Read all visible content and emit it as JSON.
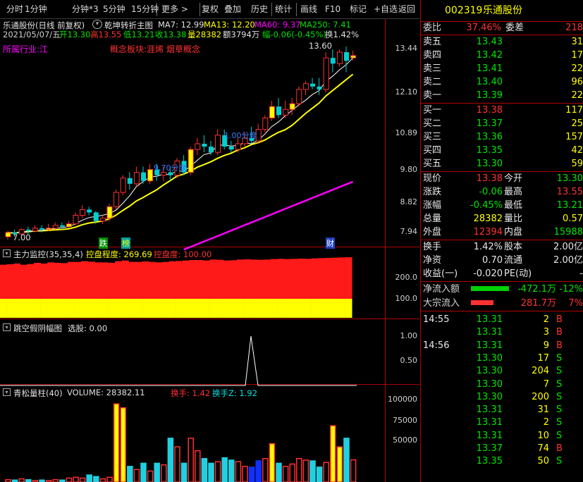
{
  "toolbar": {
    "items": [
      "分时",
      "1分钟",
      "分钟*3",
      "5分钟",
      "15分钟",
      "更多 >",
      "复权",
      "叠加",
      "历史",
      "统计",
      "画线",
      "F10",
      "标记",
      "+自选",
      "返回"
    ]
  },
  "chart_header": {
    "stock_period": "乐通股份(日线 前复权)",
    "indicator_name": "乾坤转折主图",
    "ma7": "MA7: 12.99",
    "ma13": "MA13: 12.20",
    "ma60": "MA60: 9.37",
    "ma250": "MA250: 7.41",
    "date": "2021/05/07/五",
    "open": "开13.30",
    "high": "高13.55",
    "low": "低13.21",
    "close": "收13.38",
    "volume": "量28382",
    "amount": "额3794万",
    "change": "幅-0.06(-0.45%)",
    "turnover": "换1.42%",
    "industry": "所属行业:江",
    "concepts": "概念板块:涯烯 烟草概念",
    "price_max_label": "13.60",
    "price_min_label": "7.00",
    "marker_die": "跌",
    "marker_bang": "榜",
    "marker_cai": "财",
    "band_label_1": "1.00分度",
    "band_label_2": "9.70分度"
  },
  "price_axis": [
    "13.44",
    "12.10",
    "10.89",
    "9.80",
    "8.82",
    "7.94"
  ],
  "panel2": {
    "title": "主力监控(35,35,4)",
    "ctrl_degree": "控盘程度: 269.69",
    "ctrl": "控盘度: 100.00",
    "axis": [
      "200.0",
      "100.0"
    ]
  },
  "panel3": {
    "title": "跳空假阴幅图",
    "select": "选股: 0.00",
    "axis": [
      "1.00",
      "0.50"
    ]
  },
  "panel4": {
    "title": "青松量柱(40)",
    "volume": "VOLUME: 28382.11",
    "turnover": "换手: 1.42",
    "turnover_z": "换手Z: 1.92",
    "axis": [
      "100000",
      "75000",
      "50000"
    ]
  },
  "quote": {
    "code": "002319",
    "name": "乐通股份",
    "weibi_label": "委比",
    "weibi_value": "37.46%",
    "weicha_label": "委差",
    "weicha_value": "218",
    "asks": [
      {
        "label": "卖五",
        "price": "13.43",
        "vol": "31"
      },
      {
        "label": "卖四",
        "price": "13.42",
        "vol": "17"
      },
      {
        "label": "卖三",
        "price": "13.41",
        "vol": "22"
      },
      {
        "label": "卖二",
        "price": "13.40",
        "vol": "96"
      },
      {
        "label": "卖一",
        "price": "13.39",
        "vol": "22"
      }
    ],
    "bids": [
      {
        "label": "买一",
        "price": "13.38",
        "vol": "117"
      },
      {
        "label": "买二",
        "price": "13.37",
        "vol": "25"
      },
      {
        "label": "买三",
        "price": "13.36",
        "vol": "157"
      },
      {
        "label": "买四",
        "price": "13.35",
        "vol": "42"
      },
      {
        "label": "买五",
        "price": "13.30",
        "vol": "59"
      }
    ],
    "stats": [
      {
        "l1": "现价",
        "v1": "13.38",
        "c1": "red",
        "l2": "今开",
        "v2": "13.30",
        "c2": "green"
      },
      {
        "l1": "涨跌",
        "v1": "-0.06",
        "c1": "green",
        "l2": "最高",
        "v2": "13.55",
        "c2": "red"
      },
      {
        "l1": "涨幅",
        "v1": "-0.45%",
        "c1": "green",
        "l2": "最低",
        "v2": "13.21",
        "c2": "green"
      },
      {
        "l1": "总量",
        "v1": "28382",
        "c1": "yellow",
        "l2": "量比",
        "v2": "0.57",
        "c2": "yellow"
      },
      {
        "l1": "外盘",
        "v1": "12394",
        "c1": "red",
        "l2": "内盘",
        "v2": "15988",
        "c2": "green"
      }
    ],
    "stats2": [
      {
        "l1": "换手",
        "v1": "1.42%",
        "l2": "股本",
        "v2": "2.00亿"
      },
      {
        "l1": "净资",
        "v1": "0.70",
        "l2": "流通",
        "v2": "2.00亿"
      },
      {
        "l1": "收益(一)",
        "v1": "-0.020",
        "l2": "PE(动)",
        "v2": "-"
      }
    ],
    "net_inflow_label": "净流入额",
    "net_inflow_value": "-472.1万",
    "net_inflow_pct": "-12%",
    "block_inflow_label": "大宗流入",
    "block_inflow_value": "281.7万",
    "block_inflow_pct": "7%",
    "ticks": [
      {
        "time": "14:55",
        "price": "13.31",
        "vol": "2",
        "dir": "B",
        "c": "red"
      },
      {
        "time": "",
        "price": "13.31",
        "vol": "3",
        "dir": "B",
        "c": "red"
      },
      {
        "time": "14:56",
        "price": "13.31",
        "vol": "9",
        "dir": "B",
        "c": "red"
      },
      {
        "time": "",
        "price": "13.30",
        "vol": "17",
        "dir": "S",
        "c": "green"
      },
      {
        "time": "",
        "price": "13.30",
        "vol": "204",
        "dir": "S",
        "c": "green"
      },
      {
        "time": "",
        "price": "13.30",
        "vol": "7",
        "dir": "S",
        "c": "green"
      },
      {
        "time": "",
        "price": "13.30",
        "vol": "200",
        "dir": "S",
        "c": "green"
      },
      {
        "time": "",
        "price": "13.31",
        "vol": "31",
        "dir": "S",
        "c": "green"
      },
      {
        "time": "",
        "price": "13.31",
        "vol": "2",
        "dir": "S",
        "c": "green"
      },
      {
        "time": "",
        "price": "13.31",
        "vol": "10",
        "dir": "S",
        "c": "green"
      },
      {
        "time": "",
        "price": "13.37",
        "vol": "74",
        "dir": "B",
        "c": "red"
      },
      {
        "time": "",
        "price": "13.35",
        "vol": "50",
        "dir": "S",
        "c": "green"
      }
    ]
  },
  "chart_data": {
    "type": "candlestick",
    "y_range": [
      7.0,
      13.9
    ],
    "candles": [
      [
        7.05,
        7.2,
        6.95,
        7.25
      ],
      [
        7.2,
        7.15,
        7.05,
        7.3
      ],
      [
        7.15,
        7.3,
        7.1,
        7.35
      ],
      [
        7.3,
        7.25,
        7.15,
        7.4
      ],
      [
        7.25,
        7.35,
        7.2,
        7.45
      ],
      [
        7.35,
        7.3,
        7.2,
        7.45
      ],
      [
        7.3,
        7.35,
        7.25,
        7.5
      ],
      [
        7.35,
        7.45,
        7.3,
        7.55
      ],
      [
        7.45,
        7.4,
        7.3,
        7.55
      ],
      [
        7.4,
        7.5,
        7.35,
        7.6
      ],
      [
        7.5,
        7.8,
        7.45,
        7.9
      ],
      [
        7.8,
        8.0,
        7.7,
        8.15
      ],
      [
        8.0,
        7.9,
        7.8,
        8.1
      ],
      [
        7.9,
        7.6,
        7.5,
        7.95
      ],
      [
        7.6,
        7.7,
        7.5,
        7.8
      ],
      [
        7.7,
        8.1,
        7.6,
        8.2
      ],
      [
        8.1,
        8.6,
        8.0,
        8.7
      ],
      [
        8.6,
        9.1,
        8.5,
        9.2
      ],
      [
        9.1,
        8.9,
        8.7,
        9.3
      ],
      [
        8.9,
        9.3,
        8.8,
        9.5
      ],
      [
        9.3,
        9.0,
        8.9,
        9.5
      ],
      [
        9.0,
        9.4,
        8.9,
        9.6
      ],
      [
        9.4,
        9.2,
        9.0,
        9.6
      ],
      [
        9.2,
        9.3,
        9.0,
        9.5
      ],
      [
        9.3,
        9.2,
        9.0,
        9.5
      ],
      [
        9.2,
        9.7,
        9.1,
        9.8
      ],
      [
        9.7,
        9.3,
        9.2,
        9.9
      ],
      [
        9.3,
        10.1,
        9.2,
        10.2
      ],
      [
        10.1,
        10.3,
        9.9,
        10.5
      ],
      [
        10.3,
        10.2,
        10.0,
        10.6
      ],
      [
        10.2,
        10.0,
        9.9,
        10.4
      ],
      [
        10.0,
        10.6,
        9.9,
        10.8
      ],
      [
        10.6,
        10.2,
        10.1,
        10.8
      ],
      [
        10.2,
        10.1,
        10.0,
        10.4
      ],
      [
        10.1,
        10.3,
        10.0,
        10.5
      ],
      [
        10.3,
        10.5,
        10.2,
        10.7
      ],
      [
        10.5,
        10.4,
        10.3,
        10.9
      ],
      [
        10.4,
        10.8,
        10.3,
        11.0
      ],
      [
        10.8,
        11.2,
        10.7,
        11.3
      ],
      [
        11.2,
        11.6,
        11.1,
        11.8
      ],
      [
        11.6,
        11.3,
        11.2,
        11.9
      ],
      [
        11.3,
        11.5,
        11.2,
        11.8
      ],
      [
        11.5,
        11.7,
        11.3,
        11.9
      ],
      [
        11.7,
        12.2,
        11.6,
        12.3
      ],
      [
        12.2,
        12.4,
        12.0,
        12.5
      ],
      [
        12.4,
        12.3,
        12.2,
        12.6
      ],
      [
        12.3,
        12.2,
        12.0,
        12.6
      ],
      [
        12.2,
        13.3,
        12.1,
        13.5
      ],
      [
        13.3,
        13.1,
        12.8,
        13.6
      ],
      [
        13.1,
        13.5,
        13.0,
        13.6
      ],
      [
        13.5,
        13.2,
        12.8,
        13.7
      ],
      [
        13.3,
        13.38,
        13.21,
        13.55
      ]
    ],
    "panel2_values": [
      250,
      252,
      255,
      250,
      253,
      258,
      255,
      260,
      258,
      257,
      262,
      262,
      265,
      263,
      260,
      260,
      258,
      265,
      268,
      262,
      262,
      264,
      262,
      260,
      262,
      265,
      266,
      268,
      270,
      270,
      268,
      272,
      271,
      268,
      269,
      272,
      273,
      272,
      271,
      272,
      274,
      275,
      274,
      275,
      276,
      275,
      277,
      278,
      279,
      280,
      281,
      282
    ],
    "volume": [
      3000,
      2500,
      4000,
      3000,
      2000,
      2500,
      2000,
      3000,
      2500,
      5000,
      6000,
      5000,
      9000,
      7000,
      4000,
      6000,
      100000,
      95000,
      20000,
      16000,
      24000,
      14000,
      24000,
      22000,
      56000,
      45000,
      24000,
      56000,
      40000,
      30000,
      24000,
      26000,
      31000,
      28000,
      26000,
      20000,
      19000,
      27000,
      30000,
      49000,
      24000,
      20000,
      23000,
      30000,
      28000,
      27000,
      19000,
      25000,
      72000,
      45000,
      56000,
      28382
    ]
  }
}
